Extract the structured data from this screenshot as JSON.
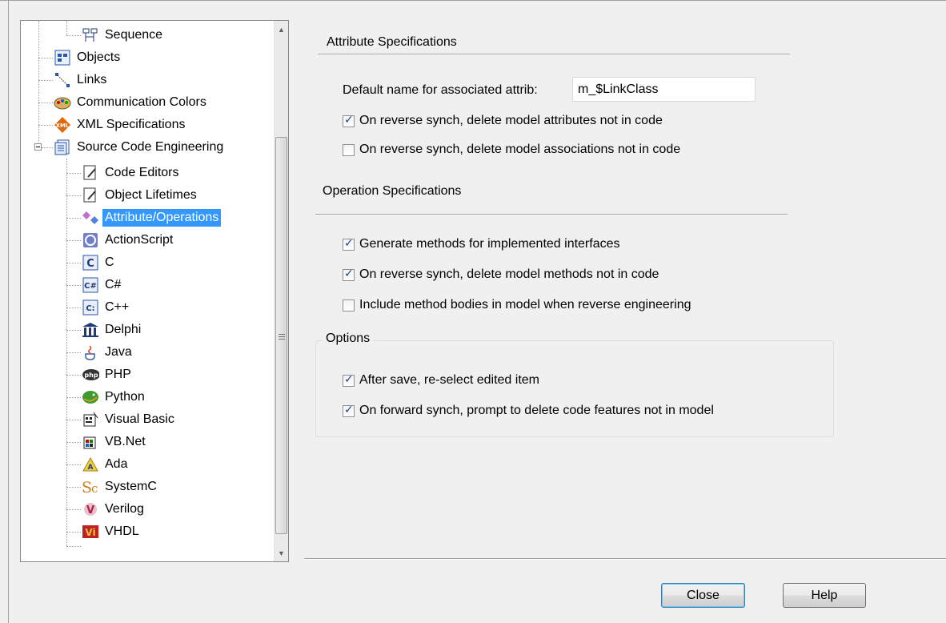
{
  "tree": {
    "items": [
      {
        "label": "Sequence",
        "icon": "sequence-icon"
      },
      {
        "label": "Objects",
        "icon": "objects-icon"
      },
      {
        "label": "Links",
        "icon": "links-icon"
      },
      {
        "label": "Communication Colors",
        "icon": "palette-icon"
      },
      {
        "label": "XML Specifications",
        "icon": "xml-icon"
      },
      {
        "label": "Source Code Engineering",
        "icon": "source-code-icon"
      },
      {
        "label": "Code Editors",
        "icon": "code-editor-icon"
      },
      {
        "label": "Object Lifetimes",
        "icon": "object-lifetimes-icon"
      },
      {
        "label": "Attribute/Operations",
        "icon": "attribute-operations-icon"
      },
      {
        "label": "ActionScript",
        "icon": "actionscript-icon"
      },
      {
        "label": "C",
        "icon": "c-lang-icon"
      },
      {
        "label": "C#",
        "icon": "csharp-icon"
      },
      {
        "label": "C++",
        "icon": "cpp-icon"
      },
      {
        "label": "Delphi",
        "icon": "delphi-icon"
      },
      {
        "label": "Java",
        "icon": "java-icon"
      },
      {
        "label": "PHP",
        "icon": "php-icon"
      },
      {
        "label": "Python",
        "icon": "python-icon"
      },
      {
        "label": "Visual Basic",
        "icon": "visual-basic-icon"
      },
      {
        "label": "VB.Net",
        "icon": "vbnet-icon"
      },
      {
        "label": "Ada",
        "icon": "ada-icon"
      },
      {
        "label": "SystemC",
        "icon": "systemc-icon"
      },
      {
        "label": "Verilog",
        "icon": "verilog-icon"
      },
      {
        "label": "VHDL",
        "icon": "vhdl-icon"
      }
    ],
    "selected": "Attribute/Operations"
  },
  "attribute_specs": {
    "title": "Attribute Specifications",
    "default_name_label": "Default name for associated attrib:",
    "default_name_value": "m_$LinkClass",
    "checks": [
      {
        "label": "On reverse synch, delete model attributes not in code",
        "checked": true
      },
      {
        "label": "On reverse synch, delete model associations not in code",
        "checked": false
      }
    ]
  },
  "operation_specs": {
    "title": "Operation Specifications",
    "checks": [
      {
        "label": "Generate methods for implemented interfaces",
        "checked": true
      },
      {
        "label": "On reverse synch, delete model methods not in code",
        "checked": true
      },
      {
        "label": "Include method bodies in model when reverse engineering",
        "checked": false
      }
    ]
  },
  "options": {
    "title": "Options",
    "checks": [
      {
        "label": "After save, re-select edited item",
        "checked": true
      },
      {
        "label": "On forward synch, prompt to delete code features not in model",
        "checked": true
      }
    ]
  },
  "buttons": {
    "close": "Close",
    "help": "Help"
  },
  "colors": {
    "selection": "#3399ff",
    "dialog_bg": "#f0f0f0"
  }
}
